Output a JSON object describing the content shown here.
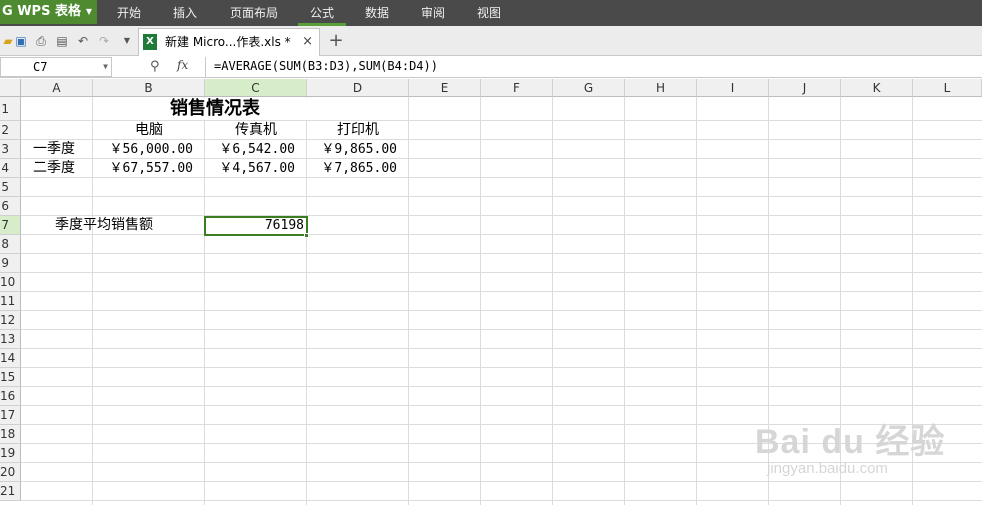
{
  "app": {
    "name": "WPS 表格",
    "logo_letter": "G"
  },
  "menu": [
    {
      "label": "开始",
      "active": false
    },
    {
      "label": "插入",
      "active": false
    },
    {
      "label": "页面布局",
      "active": false
    },
    {
      "label": "公式",
      "active": true
    },
    {
      "label": "数据",
      "active": false
    },
    {
      "label": "审阅",
      "active": false
    },
    {
      "label": "视图",
      "active": false
    }
  ],
  "toolbar": {
    "icons": [
      "folder-open-icon",
      "save-icon",
      "print-icon",
      "print-preview-icon",
      "undo-icon",
      "redo-icon",
      "dropdown-icon"
    ]
  },
  "tab": {
    "title": "新建 Micro...作表.xls *",
    "close_label": "×",
    "new_tab_label": "+"
  },
  "formula_bar": {
    "cell_ref": "C7",
    "fx_label": "fx",
    "formula": "=AVERAGE(SUM(B3:D3),SUM(B4:D4))"
  },
  "columns": [
    "A",
    "B",
    "C",
    "D",
    "E",
    "F",
    "G",
    "H",
    "I",
    "J",
    "K",
    "L"
  ],
  "selected_column": "C",
  "rows": [
    "1",
    "2",
    "3",
    "4",
    "5",
    "6",
    "7",
    "8",
    "9",
    "10",
    "11",
    "12",
    "13",
    "14",
    "15",
    "16",
    "17",
    "18",
    "19",
    "20",
    "21"
  ],
  "selected_row": "7",
  "sheet": {
    "title": "销售情况表",
    "headers": {
      "b2": "电脑",
      "c2": "传真机",
      "d2": "打印机"
    },
    "row3": {
      "label": "一季度",
      "b": "￥56,000.00",
      "c": "￥6,542.00",
      "d": "￥9,865.00"
    },
    "row4": {
      "label": "二季度",
      "b": "￥67,557.00",
      "c": "￥4,567.00",
      "d": "￥7,865.00"
    },
    "row7": {
      "label": "季度平均销售额",
      "value": "76198"
    }
  },
  "watermark": {
    "logo": "Bai du 经验",
    "sub": "jingyan.baidu.com"
  }
}
